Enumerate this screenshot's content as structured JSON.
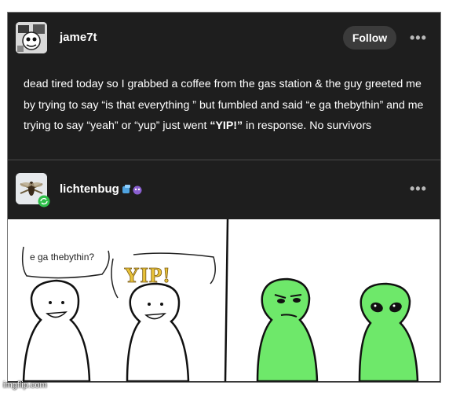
{
  "post": {
    "username": "jame7t",
    "follow_label": "Follow",
    "more_label": "•••",
    "text_before": "dead tired today so I grabbed a coffee from the gas station & the guy greeted me by trying to say “is that everything ” but fumbled and said “e ga thebythin” and me trying to say “yeah” or “yup” just went ",
    "text_bold": "“YIP!”",
    "text_after": " in response. No survivors"
  },
  "reblog": {
    "username": "lichtenbug",
    "more_label": "•••"
  },
  "comic": {
    "speech_1": "e ga thebythin?",
    "speech_2": "YIP!"
  },
  "watermark": "imgflip.com",
  "colors": {
    "background": "#1e1e1e",
    "alien_green": "#6ee86a",
    "yip_yellow": "#e8c23a"
  },
  "icons": [
    "avatar-image",
    "lichtenbug-avatar",
    "reblog-badge-icon",
    "badge-icons",
    "more-options-icon"
  ]
}
